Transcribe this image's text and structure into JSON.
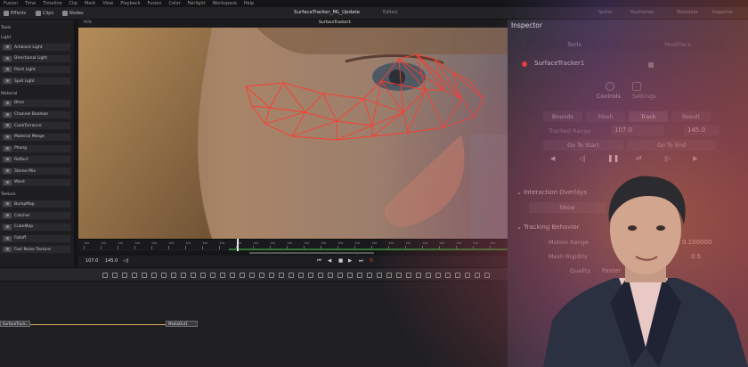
{
  "menu": [
    "Fusion",
    "Time",
    "Timeline",
    "Clip",
    "Mark",
    "View",
    "Playback",
    "Fusion",
    "Color",
    "Fairlight",
    "Workspace",
    "Help"
  ],
  "toolbar": {
    "effects_label": "Effects",
    "clips_label": "Clips",
    "nodes_label": "Nodes",
    "project_title": "SurfaceTracker_ML_Update",
    "project_status": "Edited",
    "right_items": [
      "Spline",
      "Keyframes",
      "Metadata",
      "Inspector"
    ]
  },
  "viewer": {
    "node_name": "SurfaceTracker1",
    "zoom": "76%",
    "ruler_ticks": [
      "1ds",
      "1ds",
      "1ds",
      "1ds",
      "1ds",
      "1ds",
      "1ds",
      "1ds",
      "1ds",
      "1ds",
      "1ds",
      "1ds",
      "1ds",
      "1ds",
      "1ds",
      "1ds",
      "1ds",
      "1ds",
      "1ds",
      "1ds",
      "1ds",
      "1ds",
      "1ds",
      "1ds",
      "1ds"
    ]
  },
  "transport": {
    "in": "107.0",
    "out": "145.0"
  },
  "effects_panel": {
    "categories": [
      {
        "label": "Tools",
        "items": []
      },
      {
        "label": "Light",
        "items": [
          "Ambient Light",
          "Directional Light",
          "Point Light",
          "Spot Light"
        ]
      },
      {
        "label": "Material",
        "items": [
          "Blinn",
          "Channel Boolean",
          "CookTorrance",
          "Material Merge",
          "Phong",
          "Reflect",
          "Stereo Mix",
          "Ward"
        ]
      },
      {
        "label": "Texture",
        "items": [
          "BumpMap",
          "Catcher",
          "CubeMap",
          "Falloff",
          "Fast Noise Texture"
        ]
      }
    ]
  },
  "nodes": {
    "surface_tracker": "SurfaceTrack...",
    "media_out": "MediaOut1"
  },
  "inspector": {
    "title": "Inspector",
    "top_tabs": [
      "Tools",
      "Modifiers"
    ],
    "node_name": "SurfaceTracker1",
    "sub_tabs": [
      "Controls",
      "Settings"
    ],
    "mode_buttons": [
      "Bounds",
      "Mesh",
      "Track",
      "Result"
    ],
    "active_mode": "Track",
    "tracked_range_label": "Tracked Range",
    "tracked_range_start": "107.0",
    "tracked_range_end": "145.0",
    "go_to_start": "Go To Start",
    "go_to_end": "Go To End",
    "interaction_overlays_label": "Interaction Overlays",
    "show_label": "Show",
    "tracking_behavior_label": "Tracking Behavior",
    "motion_range_label": "Motion Range",
    "motion_range_value": "0.100000",
    "mesh_rigidity_label": "Mesh Rigidity",
    "mesh_rigidity_value": "0.5",
    "quality_label": "Quality",
    "quality_value": "Faster"
  },
  "colors": {
    "accent_red": "#ff3b2f",
    "track_green": "#2e7a31",
    "link_gold": "#d8b15a"
  }
}
